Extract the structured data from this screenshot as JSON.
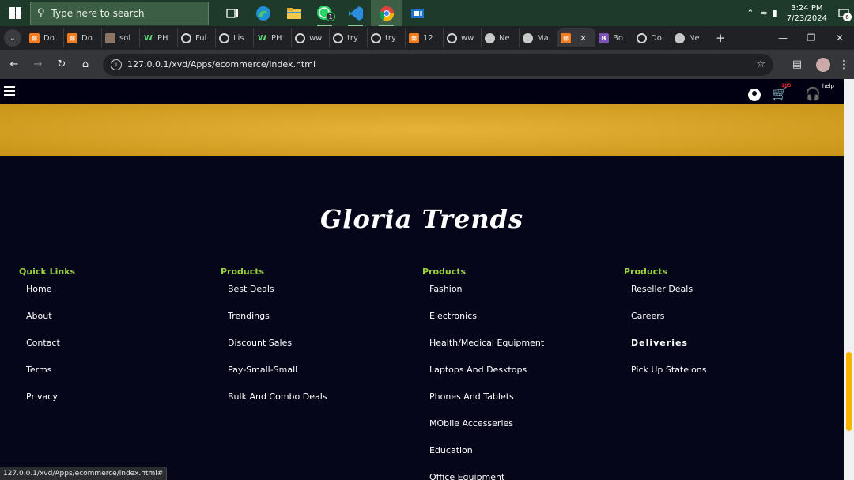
{
  "taskbar": {
    "search_placeholder": "Type here to search",
    "clock_time": "3:24 PM",
    "clock_date": "7/23/2024",
    "notification_count": "6",
    "whatsapp_badge": "1"
  },
  "browser": {
    "tabs": [
      {
        "label": "Do",
        "icon": "xampp"
      },
      {
        "label": "Do",
        "icon": "xampp"
      },
      {
        "label": "sol",
        "icon": "photo"
      },
      {
        "label": "PH",
        "icon": "w"
      },
      {
        "label": "Ful",
        "icon": "globe"
      },
      {
        "label": "Lis",
        "icon": "globe"
      },
      {
        "label": "PH",
        "icon": "w"
      },
      {
        "label": "ww",
        "icon": "globe"
      },
      {
        "label": "try",
        "icon": "globe"
      },
      {
        "label": "try",
        "icon": "globe"
      },
      {
        "label": "12",
        "icon": "xampp"
      },
      {
        "label": "ww",
        "icon": "globe"
      },
      {
        "label": "Ne",
        "icon": "chrome"
      },
      {
        "label": "Ma",
        "icon": "chrome"
      },
      {
        "label": "",
        "icon": "xampp",
        "active": true
      },
      {
        "label": "Bo",
        "icon": "bs"
      },
      {
        "label": "Do",
        "icon": "globe"
      },
      {
        "label": "Ne",
        "icon": "chrome"
      }
    ],
    "url": "127.0.0.1/xvd/Apps/ecommerce/index.html",
    "status_url": "127.0.0.1/xvd/Apps/ecommerce/index.html#"
  },
  "site": {
    "cart_count": "105",
    "help_label": "help",
    "brand": "Gloria Trends",
    "columns": [
      {
        "title": "Quick Links",
        "links": [
          "Home",
          "About",
          "Contact",
          "Terms",
          "Privacy"
        ]
      },
      {
        "title": "Products",
        "links": [
          "Best Deals",
          "Trendings",
          "Discount Sales",
          "Pay-Small-Small",
          "Bulk And Combo Deals"
        ]
      },
      {
        "title": "Products",
        "links": [
          "Fashion",
          "Electronics",
          "Health/Medical Equipment",
          "Laptops And Desktops",
          "Phones And Tablets",
          "MObile Accesseries",
          "Education",
          "Office Equipment"
        ]
      },
      {
        "title": "Products",
        "links": [
          "Reseller Deals",
          "Careers",
          "Deliveries",
          "Pick Up Stateions"
        ]
      }
    ]
  }
}
